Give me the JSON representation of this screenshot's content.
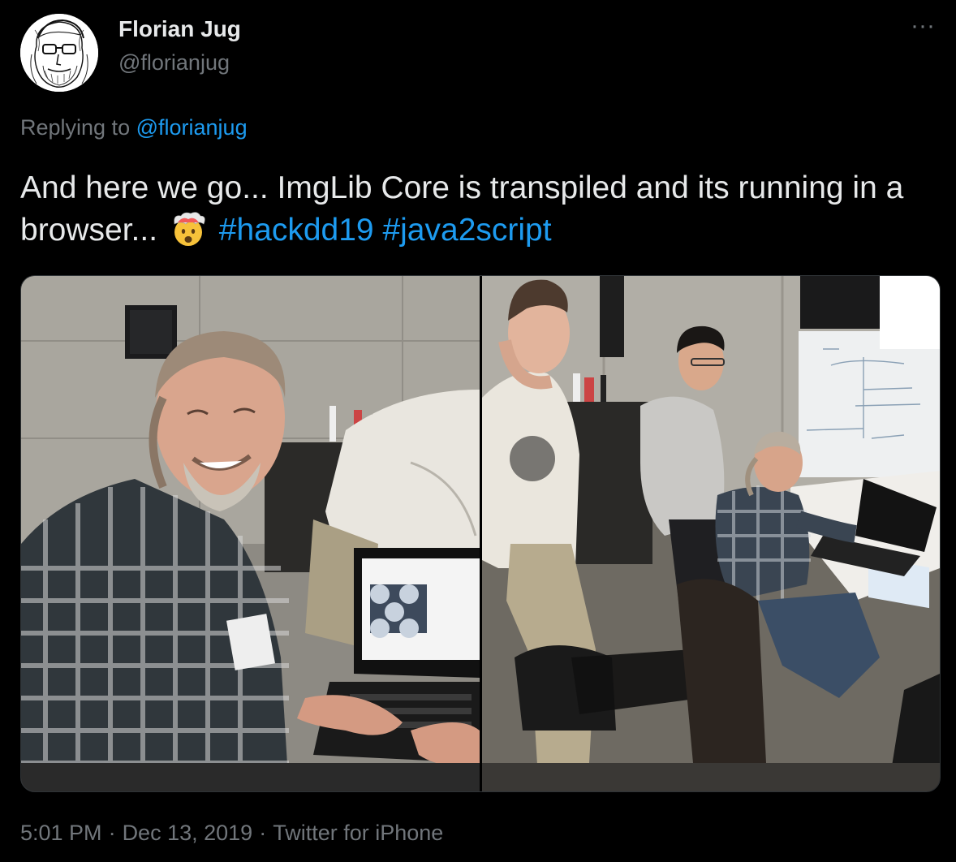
{
  "author": {
    "display_name": "Florian Jug",
    "handle": "@florianjug",
    "avatar_icon": "sketch-portrait-avatar"
  },
  "more_icon": "ellipsis-icon",
  "more_label": "···",
  "reply": {
    "prefix": "Replying to",
    "mention": "@florianjug"
  },
  "tweet": {
    "text_part1": "And here we go... ImgLib Core is transpiled and its running in a browser...",
    "emoji": "🤯",
    "hashtag1": "#hackdd19",
    "hashtag2": "#java2script"
  },
  "media": {
    "photos": [
      {
        "subject": "smiling-man-at-laptop"
      },
      {
        "subject": "group-around-laptop"
      }
    ]
  },
  "meta": {
    "time": "5:01 PM",
    "date": "Dec 13, 2019",
    "source": "Twitter for iPhone",
    "separator": "·"
  },
  "colors": {
    "background": "#000000",
    "text": "#e7e9ea",
    "secondary": "#71767b",
    "accent": "#1d9bf0"
  }
}
